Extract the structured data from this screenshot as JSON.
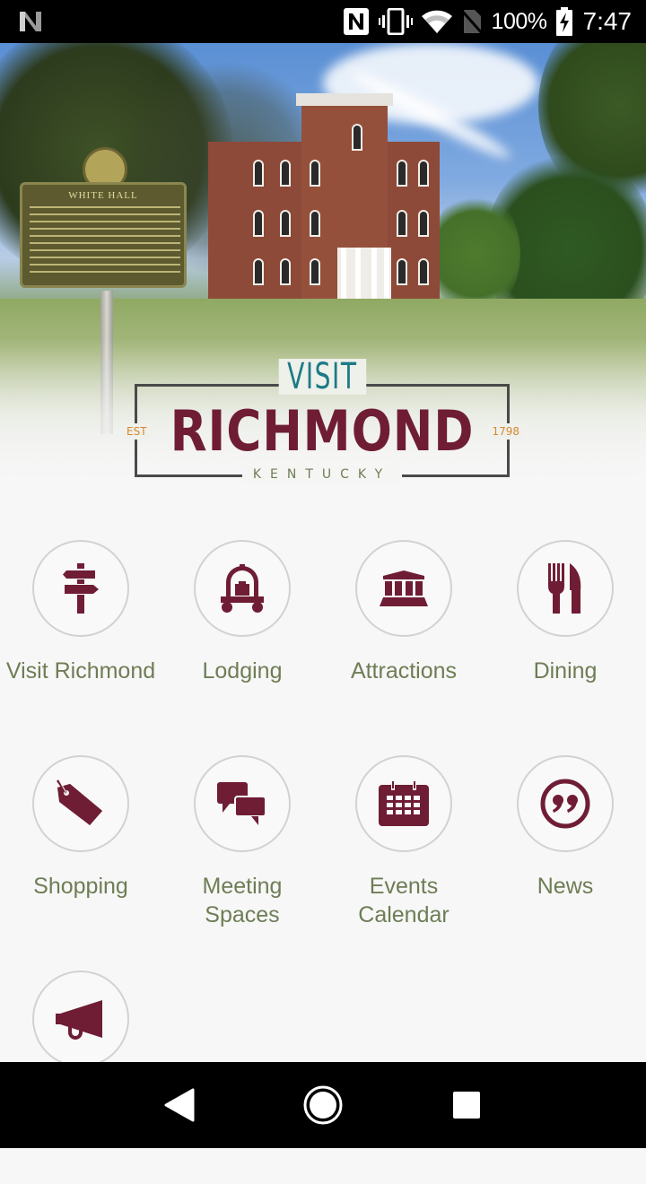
{
  "status_bar": {
    "battery_percent": "100%",
    "time": "7:47",
    "icons": [
      "android-n-icon",
      "nfc-icon",
      "vibrate-icon",
      "wifi-icon",
      "no-sim-icon",
      "battery-charging-icon"
    ]
  },
  "hero": {
    "marker_title": "WHITE HALL",
    "image_alt": "White Hall historic mansion with Kentucky historical marker"
  },
  "logo": {
    "visit": "VISIT",
    "city": "RICHMOND",
    "est": "EST",
    "year": "1798",
    "state": "KENTUCKY"
  },
  "colors": {
    "accent": "#6f1d35",
    "label": "#6e7d55",
    "visit_teal": "#1c7a86",
    "est_orange": "#d28a2c"
  },
  "menu": [
    {
      "label": "Visit Richmond",
      "icon": "signpost-icon"
    },
    {
      "label": "Lodging",
      "icon": "luggage-cart-icon"
    },
    {
      "label": "Attractions",
      "icon": "museum-icon"
    },
    {
      "label": "Dining",
      "icon": "fork-knife-icon"
    },
    {
      "label": "Shopping",
      "icon": "price-tag-icon"
    },
    {
      "label": "Meeting Spaces",
      "icon": "chat-bubbles-icon"
    },
    {
      "label": "Events Calendar",
      "icon": "calendar-icon"
    },
    {
      "label": "News",
      "icon": "quote-icon"
    },
    {
      "label": "",
      "icon": "megaphone-icon"
    }
  ],
  "nav_bar": {
    "back": "back-icon",
    "home": "home-icon",
    "recents": "recents-icon"
  }
}
